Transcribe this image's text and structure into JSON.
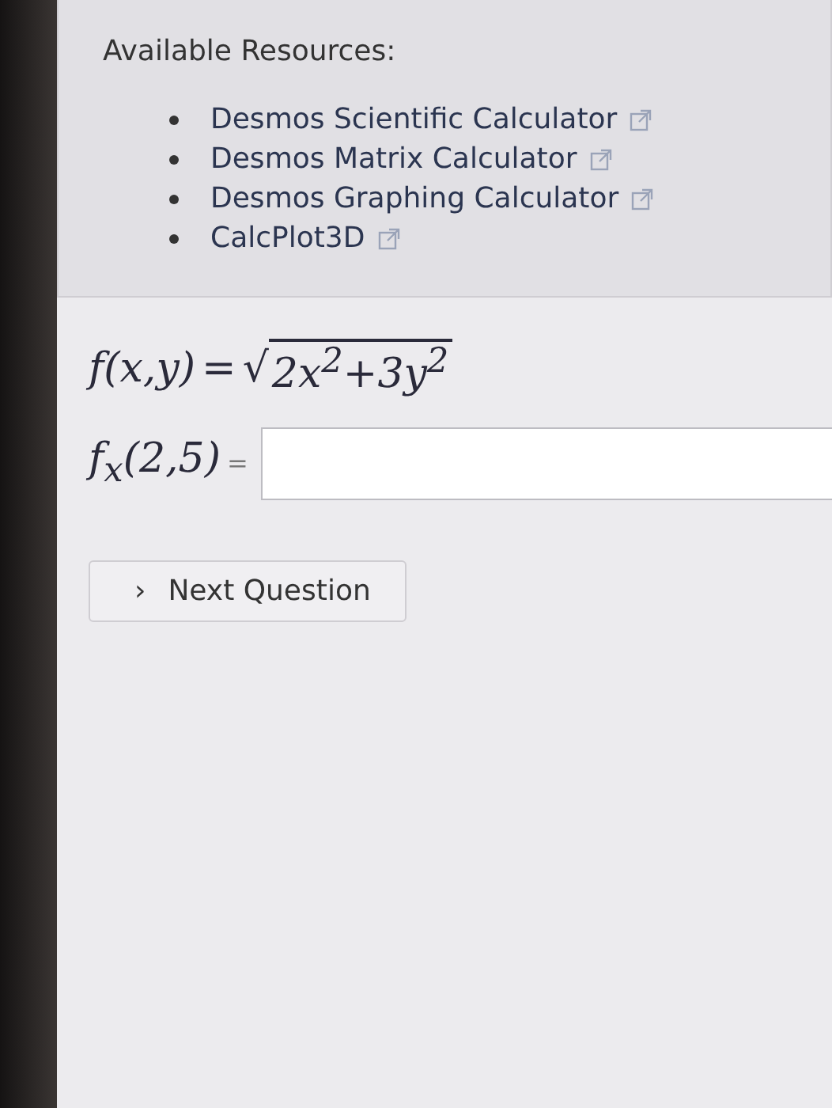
{
  "resources": {
    "title": "Available Resources:",
    "items": [
      {
        "label": "Desmos Scientific Calculator"
      },
      {
        "label": "Desmos Matrix Calculator"
      },
      {
        "label": "Desmos Graphing Calculator"
      },
      {
        "label": "CalcPlot3D"
      }
    ]
  },
  "function": {
    "lhs": "f(x,y)",
    "equals": "=",
    "radical": "√",
    "radicand": "2x$^{2}$+3y$^{2}$"
  },
  "question": {
    "label": "f$_{x}$(2,5)",
    "equals": "="
  },
  "next_button": {
    "arrow": "›",
    "label": "Next Question"
  }
}
